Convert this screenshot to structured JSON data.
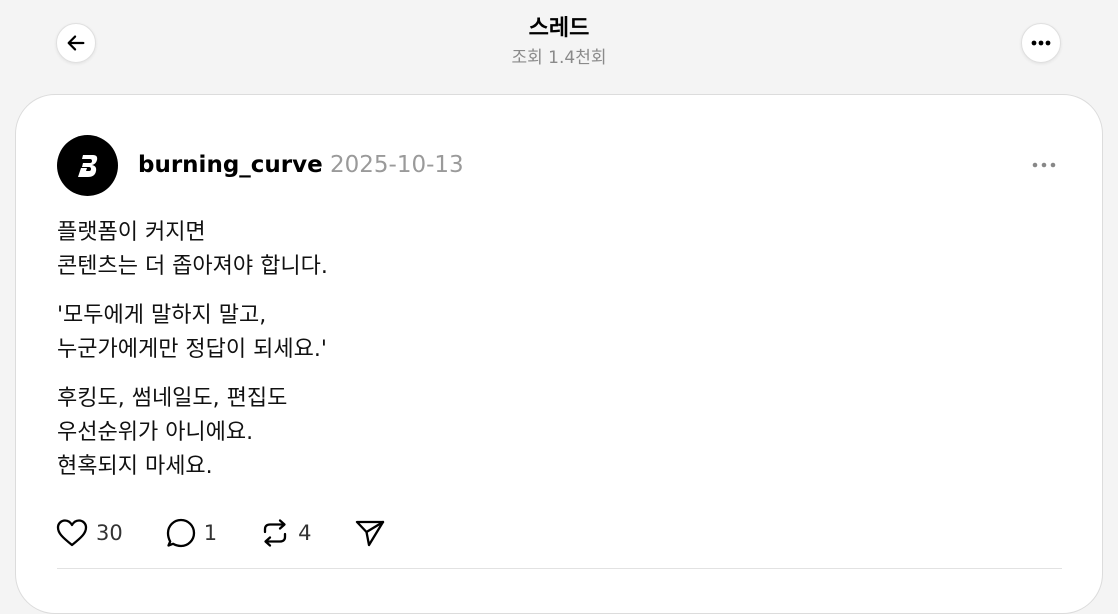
{
  "header": {
    "title": "스레드",
    "subtitle": "조회 1.4천회",
    "back_icon": "arrow-left-icon",
    "more_icon": "more-horizontal-icon"
  },
  "post": {
    "username": "burning_curve",
    "date": "2025-10-13",
    "avatar_icon": "brand-logo-icon",
    "paragraphs": [
      [
        "플랫폼이 커지면",
        "콘텐츠는 더 좁아져야 합니다."
      ],
      [
        "'모두에게 말하지 말고,",
        "누군가에게만 정답이 되세요.'"
      ],
      [
        "후킹도, 썸네일도, 편집도",
        "우선순위가 아니에요.",
        "현혹되지 마세요."
      ]
    ],
    "actions": {
      "likes": "30",
      "comments": "1",
      "reposts": "4"
    }
  },
  "colors": {
    "background": "#f4f4f4",
    "card": "#ffffff",
    "muted_text": "#9a9a9a"
  }
}
